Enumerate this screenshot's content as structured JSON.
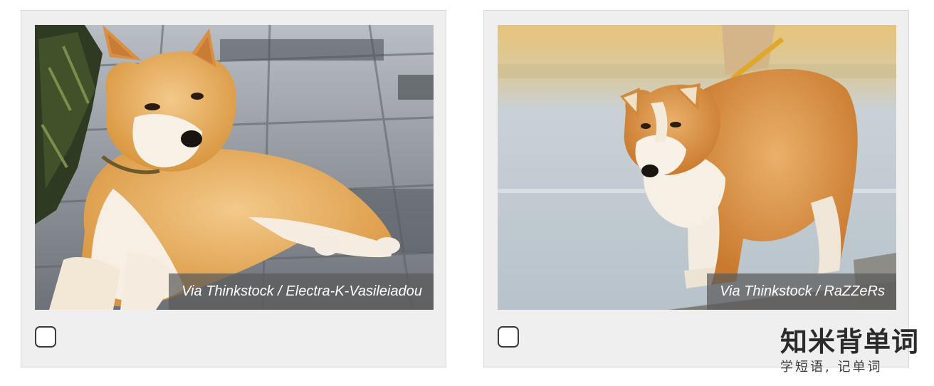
{
  "cards": [
    {
      "image_subject": "shiba-inu-dog-lying-on-pavement",
      "credit": "Via Thinkstock / Electra-K-Vasileiadou",
      "checked": false
    },
    {
      "image_subject": "akita-dog-walking-on-street",
      "credit": "Via Thinkstock / RaZZeRs",
      "checked": false
    }
  ],
  "watermark": {
    "title": "知米背单词",
    "subtitle": "学短语, 记单词"
  },
  "colors": {
    "card_bg": "#efefef",
    "card_border": "#d8d8d8",
    "credit_bg": "#5a5a5a",
    "credit_text": "#ffffff",
    "checkbox_border": "#3a3a3a"
  }
}
